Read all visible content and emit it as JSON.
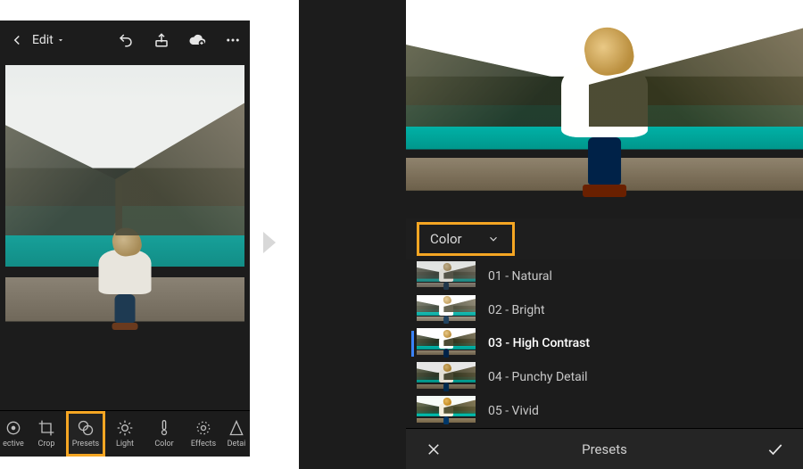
{
  "topbar": {
    "edit_label": "Edit"
  },
  "tools": {
    "selective": "ective",
    "crop": "Crop",
    "presets": "Presets",
    "light": "Light",
    "color": "Color",
    "effects": "Effects",
    "detail": "Detai"
  },
  "preset_panel": {
    "category": "Color",
    "items": [
      {
        "label": "01 - Natural"
      },
      {
        "label": "02 - Bright"
      },
      {
        "label": "03 - High Contrast"
      },
      {
        "label": "04 - Punchy Detail"
      },
      {
        "label": "05 - Vivid"
      }
    ],
    "selected_index": 2,
    "footer_title": "Presets"
  }
}
